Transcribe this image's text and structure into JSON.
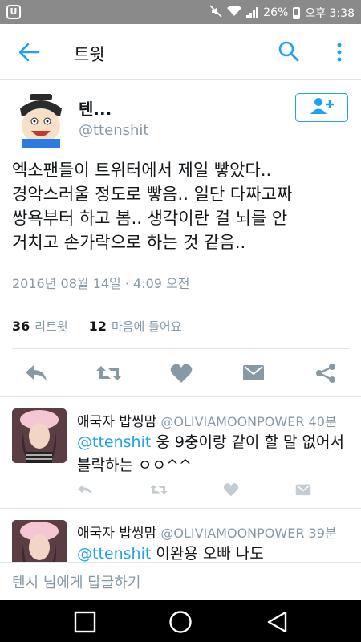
{
  "status_bar": {
    "battery": "26%",
    "time": "오후 3:38",
    "left_icon": "U"
  },
  "app_bar": {
    "title": "트윗"
  },
  "tweet": {
    "author_name": "텐...",
    "author_handle": "@ttenshit",
    "text_lines": [
      "엑소팬들이 트위터에서 제일 빻았다..",
      "경악스러울 정도로 빻음.. 일단 다짜고짜",
      "쌍욕부터 하고 봄.. 생각이란 걸 뇌를 안",
      "거치고 손가락으로 하는 것 같음.."
    ],
    "timestamp": "2016년 08월 14일 · 4:09 오전",
    "retweet_count": "36",
    "retweet_label": "리트윗",
    "like_count": "12",
    "like_label": "마음에 들어요"
  },
  "replies": [
    {
      "name": "애국자 밥씽맘",
      "handle": "@OLIVIAMOONPOWER",
      "time": "40분",
      "mention": "@ttenshit",
      "text_after_mention": " 웅 9충이랑 같이 할 말 없어서",
      "text_line2": "블락하는 ㅇㅇ^^"
    },
    {
      "name": "애국자 밥씽맘",
      "handle": "@OLIVIAMOONPOWER",
      "time": "39분",
      "mention": "@ttenshit",
      "text_after_mention": " 이완용 오빠 나도"
    }
  ],
  "reply_bar": {
    "placeholder": "텐시 님에게 답글하기"
  },
  "colors": {
    "accent": "#1da1f2",
    "icon_gray": "#8899a6",
    "status_bar": "#8a8a8a"
  }
}
